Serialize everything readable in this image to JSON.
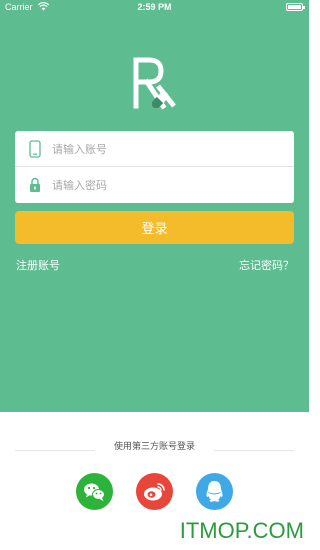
{
  "status_bar": {
    "carrier": "Carrier",
    "time": "2:59 PM"
  },
  "colors": {
    "green": "#5ebd90",
    "button_yellow": "#f4bc2b",
    "wechat_green": "#2bb33a",
    "weibo_red": "#e9463b",
    "qq_blue": "#3fa9e8"
  },
  "form": {
    "account_placeholder": "请输入账号",
    "password_placeholder": "请输入密码",
    "account_icon": "phone-icon",
    "password_icon": "lock-icon"
  },
  "login_button": "登录",
  "links": {
    "register": "注册账号",
    "forgot_password": "忘记密码？"
  },
  "third_party": {
    "title": "使用第三方账号登录",
    "providers": [
      "wechat-icon",
      "weibo-icon",
      "qq-icon"
    ]
  },
  "watermark": "ITMOP.COM"
}
